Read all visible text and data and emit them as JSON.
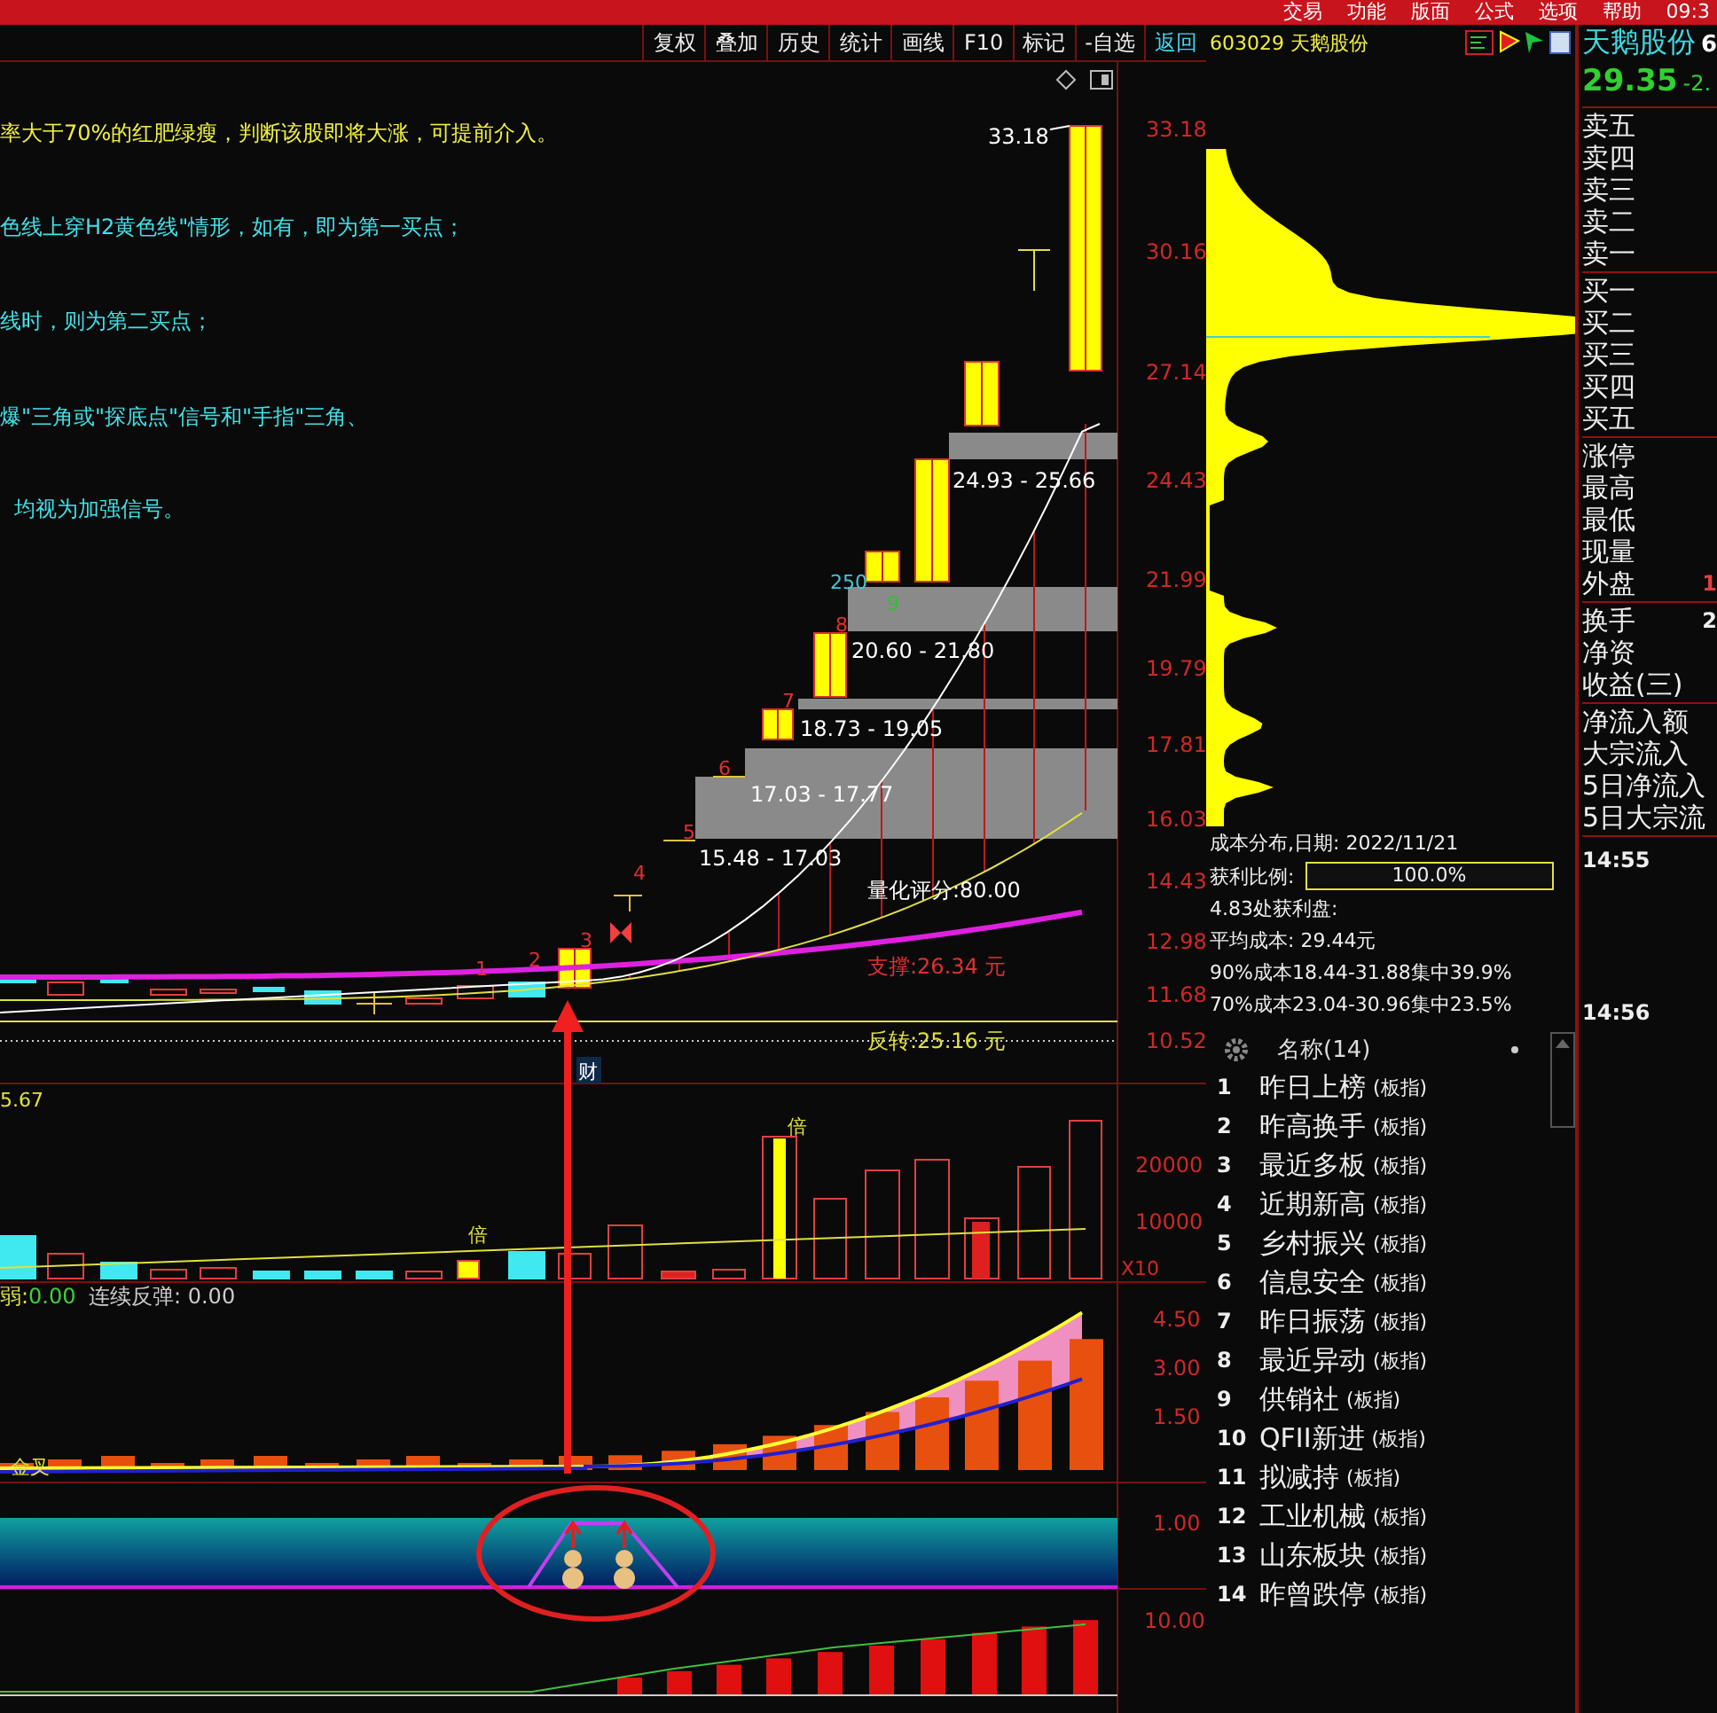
{
  "menu_bar": {
    "items": [
      "交易",
      "功能",
      "版面",
      "公式",
      "选项",
      "帮助"
    ],
    "clock": "09:3"
  },
  "toolbar": [
    {
      "label": "复权",
      "selected": false
    },
    {
      "label": "叠加",
      "selected": false
    },
    {
      "label": "历史",
      "selected": false
    },
    {
      "label": "统计",
      "selected": false
    },
    {
      "label": "画线",
      "selected": false
    },
    {
      "label": "F10",
      "selected": false
    },
    {
      "label": "标记",
      "selected": false
    },
    {
      "label": "-自选",
      "selected": false
    },
    {
      "label": "返回",
      "selected": true
    }
  ],
  "chart": {
    "notes": [
      {
        "text": "率大于70%的红肥绿瘦，判断该股即将大涨，可提前介入。",
        "color": "#f0f040"
      },
      {
        "text": "色线上穿H2黄色线\"情形，如有，即为第一买点；",
        "color": "#40e0e8"
      },
      {
        "text": "线时，则为第二买点；",
        "color": "#40e0e8"
      },
      {
        "text": "爆\"三角或\"探底点\"信号和\"手指\"三角、",
        "color": "#40e0e8"
      },
      {
        "text": "均视为加强信号。",
        "color": "#40e0e8"
      }
    ],
    "price_axis": [
      "33.18",
      "30.16",
      "27.14",
      "24.43",
      "21.99",
      "19.79",
      "17.81",
      "16.03",
      "14.43",
      "12.98",
      "11.68",
      "10.52"
    ],
    "high_label": "33.18",
    "ranges": [
      "24.93 - 25.66",
      "20.60 - 21.80",
      "18.73 - 19.05",
      "17.03 - 17.77",
      "15.48 - 17.03"
    ],
    "markers": [
      {
        "label": "1",
        "color": "#e03030"
      },
      {
        "label": "2",
        "color": "#e03030"
      },
      {
        "label": "3",
        "color": "#e03030"
      },
      {
        "label": "4",
        "color": "#e03030"
      },
      {
        "label": "5",
        "color": "#e03030"
      },
      {
        "label": "6",
        "color": "#e03030"
      },
      {
        "label": "7",
        "color": "#e03030"
      },
      {
        "label": "8",
        "color": "#e03030"
      },
      {
        "label": "9",
        "color": "#30c030"
      },
      {
        "label": "250",
        "color": "#40c8d8"
      }
    ],
    "score": "量化评分:80.00",
    "support": "支撑:26.34 元",
    "reversal": "反转:25.16 元",
    "tag": "财"
  },
  "volume": {
    "value": "5.67",
    "axis": [
      "20000",
      "10000"
    ],
    "unit": "X10",
    "flags": [
      "倍",
      "倍"
    ]
  },
  "indicator": {
    "strength_label": "弱:",
    "strength": "0.00",
    "rebound_label": "连续反弹:",
    "rebound": "0.00",
    "axis": [
      "4.50",
      "3.00",
      "1.50"
    ],
    "cross": "金叉"
  },
  "signal": {
    "axis": "1.00"
  },
  "oscillator": {
    "axis": "10.00"
  },
  "chip": {
    "code": "603029",
    "name": "天鹅股份",
    "date_label": "成本分布,日期:",
    "date": "2022/11/21",
    "profit_label": "获利比例:",
    "profit": "100.0%",
    "level": 1,
    "lines": [
      "4.83处获利盘:",
      "平均成本: 29.44元",
      "90%成本18.44-31.88集中39.9%",
      "70%成本23.04-30.96集中23.5%"
    ]
  },
  "quote": {
    "name": "天鹅股份",
    "name_cut": "6",
    "price": "29.35",
    "change": "-2.",
    "groups": [
      {
        "rows": [
          {
            "label": "卖五"
          },
          {
            "label": "卖四"
          },
          {
            "label": "卖三"
          },
          {
            "label": "卖二"
          },
          {
            "label": "卖一"
          }
        ]
      },
      {
        "rows": [
          {
            "label": "买一"
          },
          {
            "label": "买二"
          },
          {
            "label": "买三"
          },
          {
            "label": "买四"
          },
          {
            "label": "买五"
          }
        ]
      },
      {
        "rows": [
          {
            "label": "涨停"
          },
          {
            "label": "最高"
          },
          {
            "label": "最低"
          },
          {
            "label": "现量"
          },
          {
            "label": "外盘",
            "value": "1"
          }
        ]
      },
      {
        "rows": [
          {
            "label": "换手",
            "value": "2"
          },
          {
            "label": "净资"
          },
          {
            "label": "收益(三)"
          }
        ]
      },
      {
        "rows": [
          {
            "label": "净流入额"
          },
          {
            "label": "大宗流入"
          },
          {
            "label": "5日净流入"
          },
          {
            "label": "5日大宗流"
          }
        ]
      }
    ],
    "times": [
      "14:55",
      "14:56"
    ]
  },
  "list": {
    "header": "名称(14)",
    "rows": [
      {
        "num": "1",
        "name": "昨日上榜",
        "tag": "(板指)"
      },
      {
        "num": "2",
        "name": "昨高换手",
        "tag": "(板指)"
      },
      {
        "num": "3",
        "name": "最近多板",
        "tag": "(板指)"
      },
      {
        "num": "4",
        "name": "近期新高",
        "tag": "(板指)"
      },
      {
        "num": "5",
        "name": "乡村振兴",
        "tag": "(板指)"
      },
      {
        "num": "6",
        "name": "信息安全",
        "tag": "(板指)"
      },
      {
        "num": "7",
        "name": "昨日振荡",
        "tag": "(板指)"
      },
      {
        "num": "8",
        "name": "最近异动",
        "tag": "(板指)"
      },
      {
        "num": "9",
        "name": "供销社",
        "tag": "(板指)"
      },
      {
        "num": "10",
        "name": "QFII新进",
        "tag": "(板指)"
      },
      {
        "num": "11",
        "name": "拟减持",
        "tag": "(板指)"
      },
      {
        "num": "12",
        "name": "工业机械",
        "tag": "(板指)"
      },
      {
        "num": "13",
        "name": "山东板块",
        "tag": "(板指)"
      },
      {
        "num": "14",
        "name": "昨曾跌停",
        "tag": "(板指)"
      }
    ]
  }
}
